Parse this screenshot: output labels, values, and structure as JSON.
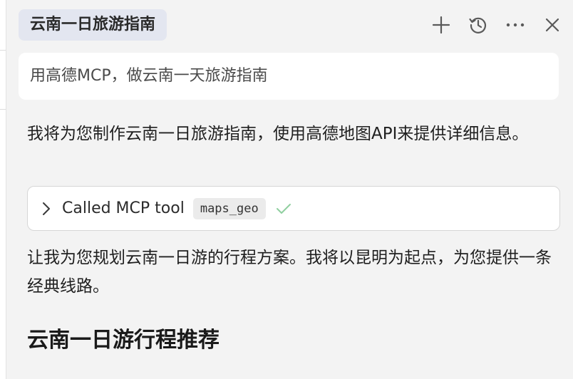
{
  "header": {
    "title": "云南一日旅游指南",
    "icons": [
      "plus-icon",
      "history-icon",
      "more-icon",
      "close-icon"
    ]
  },
  "query": {
    "text": "用高德MCP，做云南一天旅游指南"
  },
  "messages": {
    "intro": "我将为您制作云南一日旅游指南，使用高德地图API来提供详细信息。",
    "plan": "让我为您规划云南一日游的行程方案。我将以昆明为起点，为您提供一条经典线路。"
  },
  "tool_call": {
    "label": "Called MCP tool",
    "tool_name": "maps_geo",
    "status_icon": "check-icon"
  },
  "section": {
    "heading": "云南一日游行程推荐"
  },
  "colors": {
    "background": "#f3f3f3",
    "title_chip": "#e3e6f0",
    "check": "#8fcf9f"
  }
}
